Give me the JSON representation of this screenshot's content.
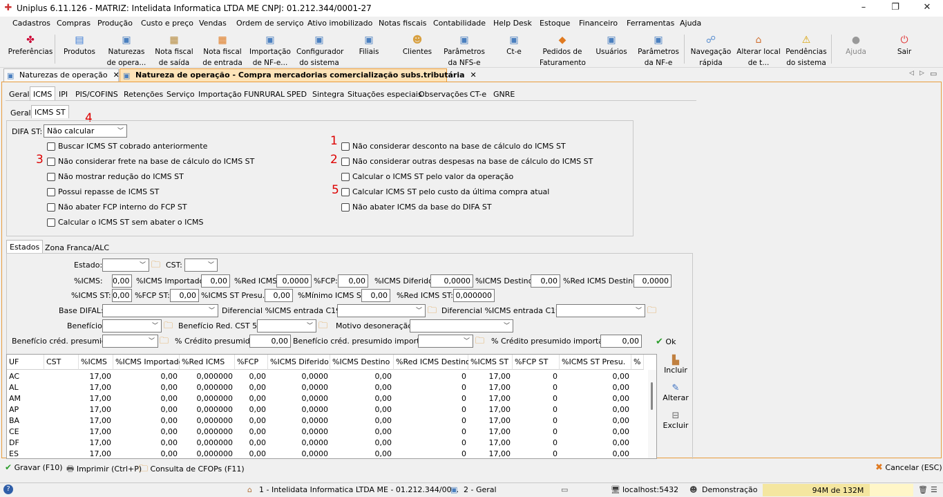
{
  "window": {
    "title": "Uniplus 6.11.126 - MATRIZ: Intelidata Informatica LTDA ME CNPJ: 01.212.344/0001-27",
    "minimize": "–",
    "maximize": "❐",
    "close": "✕"
  },
  "menu": [
    "Cadastros",
    "Compras",
    "Produção",
    "Custo e preço",
    "Vendas",
    "Ordem de serviço",
    "Ativo imobilizado",
    "Notas fiscais",
    "Contabilidade",
    "Help Desk",
    "Estoque",
    "Financeiro",
    "Ferramentas",
    "Ajuda"
  ],
  "toolbar": [
    {
      "l1": "Preferências",
      "l2": "",
      "icon": "preferences-icon"
    },
    {
      "l1": "Produtos",
      "l2": "",
      "icon": "products-icon"
    },
    {
      "l1": "Naturezas",
      "l2": "de opera...",
      "icon": "nature-icon"
    },
    {
      "l1": "Nota fiscal",
      "l2": "de saída",
      "icon": "outgoing-invoice-icon"
    },
    {
      "l1": "Nota fiscal",
      "l2": "de entrada",
      "icon": "incoming-invoice-icon"
    },
    {
      "l1": "Importação",
      "l2": "de NF-e...",
      "icon": "import-icon"
    },
    {
      "l1": "Configurador",
      "l2": "do sistema",
      "icon": "config-icon"
    },
    {
      "l1": "Filiais",
      "l2": "",
      "icon": "branches-icon"
    },
    {
      "l1": "Clientes",
      "l2": "",
      "icon": "clients-icon"
    },
    {
      "l1": "Parâmetros",
      "l2": "da NFS-e",
      "icon": "nfse-params-icon"
    },
    {
      "l1": "Ct-e",
      "l2": "",
      "icon": "cte-icon"
    },
    {
      "l1": "Pedidos de",
      "l2": "Faturamento",
      "icon": "orders-icon"
    },
    {
      "l1": "Usuários",
      "l2": "",
      "icon": "users-icon"
    },
    {
      "l1": "Parâmetros",
      "l2": "da NF-e",
      "icon": "nfe-params-icon"
    },
    {
      "l1": "Navegação",
      "l2": "rápida",
      "icon": "navigation-icon"
    },
    {
      "l1": "Alterar local",
      "l2": "de t...",
      "icon": "home-icon"
    },
    {
      "l1": "Pendências",
      "l2": "do sistema",
      "icon": "warning-icon"
    },
    {
      "l1": "Ajuda",
      "l2": "",
      "icon": "help-icon"
    },
    {
      "l1": "Sair",
      "l2": "",
      "icon": "power-icon"
    }
  ],
  "doctabs": [
    {
      "label": "Naturezas de operação",
      "close": "✕"
    },
    {
      "label": "Natureza de operação - Compra mercadorias comercialização subs.tributária",
      "close": "✕"
    }
  ],
  "tabs": [
    "Geral",
    "ICMS",
    "IPI",
    "PIS/COFINS",
    "Retenções",
    "Serviço",
    "Importação",
    "FUNRURAL",
    "SPED",
    "Sintegra",
    "Situações especiais",
    "Observações",
    "CT-e",
    "GNRE"
  ],
  "subtabs": [
    "Geral",
    "ICMS ST"
  ],
  "difa": {
    "label": "DIFA ST:",
    "value": "Não calcular"
  },
  "markers": {
    "m1": "1",
    "m2": "2",
    "m3": "3",
    "m4": "4",
    "m5": "5"
  },
  "left_checks": [
    "Buscar ICMS ST cobrado anteriormente",
    "Não considerar frete na base de cálculo do ICMS ST",
    "Não mostrar redução do ICMS ST",
    "Possui repasse de ICMS ST",
    "Não abater FCP interno do FCP ST",
    "Calcular o ICMS ST sem abater o ICMS"
  ],
  "right_checks": [
    "Não considerar desconto na base de cálculo do ICMS ST",
    "Não considerar outras despesas na base de cálculo do ICMS ST",
    "Calcular o ICMS ST pelo valor da operação",
    "Calcular ICMS ST pelo custo da última compra atual",
    "Não abater ICMS da base do DIFA ST"
  ],
  "statetabs": [
    "Estados",
    "Zona Franca/ALC"
  ],
  "form": {
    "estado": "Estado:",
    "cst": "CST:",
    "icms": "%ICMS:",
    "icms_v": "0,00",
    "icms_imp": "%ICMS Importado:",
    "icms_imp_v": "0,00",
    "red_icms": "%Red ICMS:",
    "red_icms_v": "0,0000",
    "fcp": "%FCP:",
    "fcp_v": "0,00",
    "icms_dif": "%ICMS Diferido:",
    "icms_dif_v": "0,0000",
    "icms_dest": "%ICMS Destino:",
    "icms_dest_v": "0,00",
    "red_dest": "%Red ICMS Destino:",
    "red_dest_v": "0,0000",
    "icms_st": "%ICMS ST:",
    "icms_st_v": "0,00",
    "fcp_st": "%FCP ST:",
    "fcp_st_v": "0,00",
    "st_presu": "%ICMS ST Presu.:",
    "st_presu_v": "0,00",
    "minimo": "%Mínimo ICMS ST:",
    "minimo_v": "0,00",
    "red_st": "%Red ICMS ST:",
    "red_st_v": "0,000000",
    "base_difal": "Base DIFAL:",
    "dif195": "Diferencial %ICMS entrada C195:",
    "dif197": "Diferencial %ICMS entrada C197:",
    "beneficio": "Benefício:",
    "ben_red": "Benefício Red. CST 51:",
    "motivo": "Motivo desoneração :",
    "ben_cred": "Benefício créd. presumido:",
    "cred_pres": "% Crédito presumido:",
    "cred_pres_v": "0,00",
    "ben_cred_imp": "Benefício créd. presumido importado:",
    "cred_pres_imp": "% Crédito presumido importado:",
    "cred_pres_imp_v": "0,00",
    "ok": "Ok"
  },
  "grid": {
    "headers": [
      "UF",
      "CST",
      "%ICMS",
      "%ICMS Importado",
      "%Red ICMS",
      "%FCP",
      "%ICMS Diferido",
      "%ICMS Destino",
      "%Red ICMS Destino",
      "%ICMS ST",
      "%FCP ST",
      "%ICMS ST Presu.",
      "%"
    ],
    "rows": [
      [
        "AC",
        "",
        "17,00",
        "0,00",
        "0,000000",
        "0,00",
        "0,0000",
        "0,00",
        "0",
        "17,00",
        "0",
        "0,00"
      ],
      [
        "AL",
        "",
        "17,00",
        "0,00",
        "0,000000",
        "0,00",
        "0,0000",
        "0,00",
        "0",
        "17,00",
        "0",
        "0,00"
      ],
      [
        "AM",
        "",
        "17,00",
        "0,00",
        "0,000000",
        "0,00",
        "0,0000",
        "0,00",
        "0",
        "17,00",
        "0",
        "0,00"
      ],
      [
        "AP",
        "",
        "17,00",
        "0,00",
        "0,000000",
        "0,00",
        "0,0000",
        "0,00",
        "0",
        "17,00",
        "0",
        "0,00"
      ],
      [
        "BA",
        "",
        "17,00",
        "0,00",
        "0,000000",
        "0,00",
        "0,0000",
        "0,00",
        "0",
        "17,00",
        "0",
        "0,00"
      ],
      [
        "CE",
        "",
        "17,00",
        "0,00",
        "0,000000",
        "0,00",
        "0,0000",
        "0,00",
        "0",
        "17,00",
        "0",
        "0,00"
      ],
      [
        "DF",
        "",
        "17,00",
        "0,00",
        "0,000000",
        "0,00",
        "0,0000",
        "0,00",
        "0",
        "17,00",
        "0",
        "0,00"
      ],
      [
        "ES",
        "",
        "17,00",
        "0,00",
        "0,000000",
        "0,00",
        "0,0000",
        "0,00",
        "0",
        "17,00",
        "0",
        "0,00"
      ]
    ]
  },
  "side_actions": [
    "Incluir",
    "Alterar",
    "Excluir"
  ],
  "bottom": {
    "save": "Gravar (F10)",
    "print": "Imprimir (Ctrl+P)",
    "cfop": "Consulta de CFOPs (F11)",
    "cancel": "Cancelar (ESC)"
  },
  "status": {
    "company": "1 - Intelidata Informatica LTDA ME - 01.212.344/00...",
    "module": "2 - Geral",
    "server": "localhost:5432",
    "user": "Demonstração",
    "memory": "94M de 132M",
    "memory_fill": 0.71
  }
}
